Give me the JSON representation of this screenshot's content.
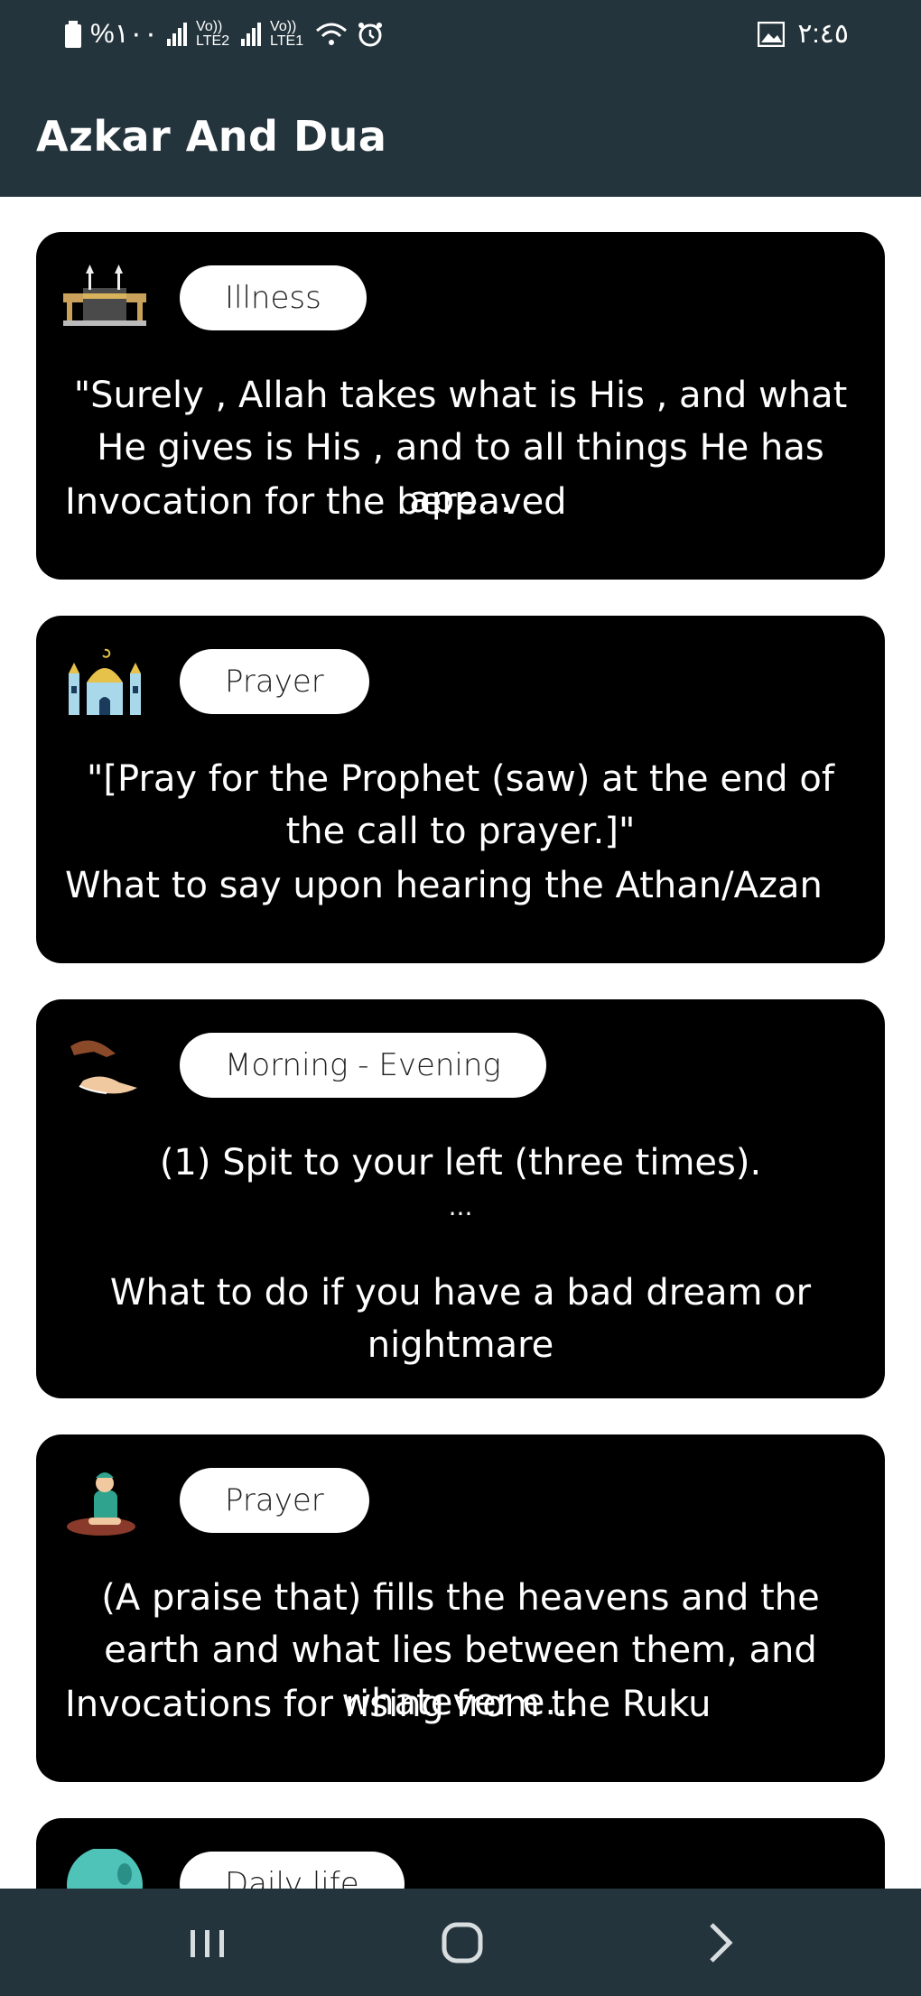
{
  "status_bar": {
    "battery_text": "%١٠٠",
    "network_1": "Vo)) LTE2",
    "network_2": "Vo)) LTE1",
    "time": "٢:٤٥"
  },
  "app_bar": {
    "title": "Azkar And Dua"
  },
  "cards": [
    {
      "icon": "kaaba-icon",
      "category": "Illness",
      "quote": "\"Surely , Allah takes what is His , and what He gives is His , and to all things He has app...",
      "title": "Invocation for the bereaved"
    },
    {
      "icon": "mosque-icon",
      "category": "Prayer",
      "quote": "\"[Pray for the Prophet (saw) at the end of the call to prayer.]\"",
      "title": "What to say upon hearing the Athan/Azan"
    },
    {
      "icon": "praying-hands-icon",
      "category": "Morning - Evening",
      "quote": "(1) Spit to your left (three times).",
      "quote_more": "...",
      "title": "What to do if you have a bad dream or nightmare"
    },
    {
      "icon": "person-praying-icon",
      "category": "Prayer",
      "quote": "(A praise that) fills the heavens and the earth and what lies between them, and whatever e...",
      "title": "Invocations for rising from the Ruku"
    },
    {
      "icon": "daily-life-icon",
      "category": "Daily life"
    }
  ],
  "nav_bar": {
    "recents": "recents-icon",
    "home": "home-icon",
    "back": "back-chevron-icon"
  },
  "colors": {
    "bar_background": "#24343c",
    "card_background": "#000000",
    "chip_background": "#ffffff"
  }
}
